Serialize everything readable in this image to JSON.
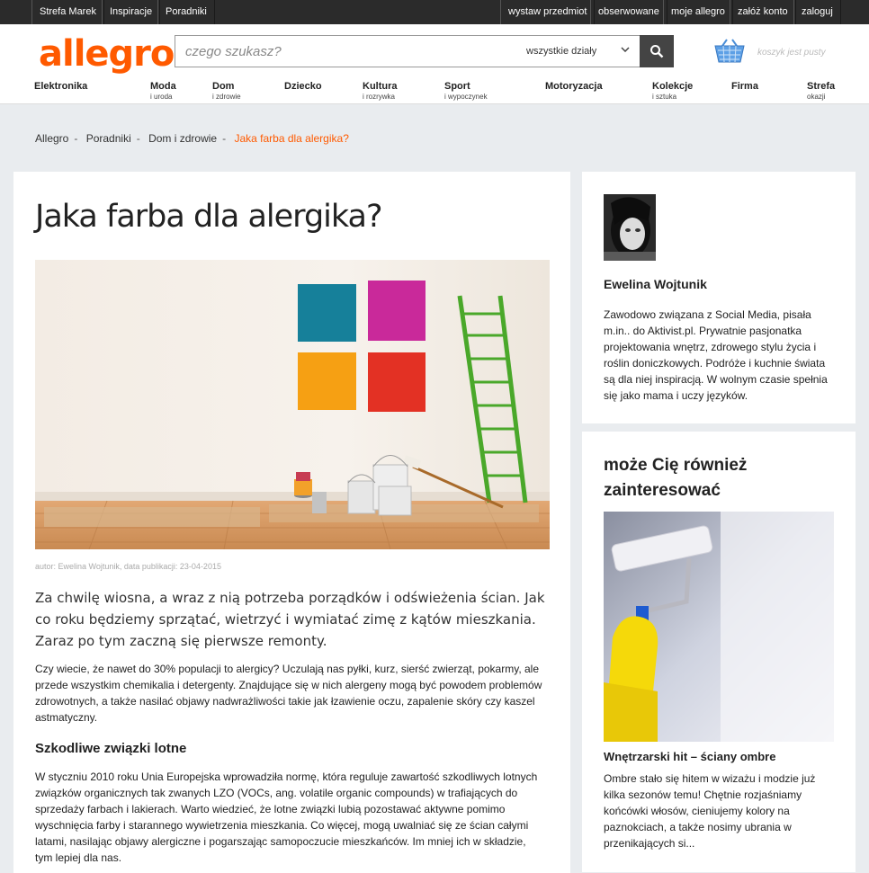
{
  "topbar": {
    "left_links": [
      "Strefa Marek",
      "Inspiracje",
      "Poradniki"
    ],
    "right_links": [
      "wystaw przedmiot",
      "obserwowane",
      "moje allegro",
      "załóż konto",
      "zaloguj"
    ]
  },
  "header": {
    "logo": "allegro",
    "search_placeholder": "czego szukasz?",
    "department": "wszystkie działy",
    "basket_status": "koszyk jest pusty",
    "brand_color": "#ff5a00"
  },
  "categories": [
    {
      "main": "Elektronika",
      "sub": ""
    },
    {
      "main": "Moda",
      "sub": "i uroda"
    },
    {
      "main": "Dom",
      "sub": "i zdrowie"
    },
    {
      "main": "Dziecko",
      "sub": ""
    },
    {
      "main": "Kultura",
      "sub": "i rozrywka"
    },
    {
      "main": "Sport",
      "sub": "i wypoczynek"
    },
    {
      "main": "Motoryzacja",
      "sub": ""
    },
    {
      "main": "Kolekcje",
      "sub": "i sztuka"
    },
    {
      "main": "Firma",
      "sub": ""
    },
    {
      "main": "Strefa",
      "sub": "okazji"
    }
  ],
  "breadcrumb": [
    "Allegro",
    "Poradniki",
    "Dom i zdrowie",
    "Jaka farba dla alergika?"
  ],
  "article": {
    "title": "Jaka farba dla alergika?",
    "byline": "autor: Ewelina Wojtunik, data publikacji: 23-04-2015",
    "lead": "Za chwilę wiosna, a wraz z nią potrzeba porządków i odświeżenia ścian. Jak co roku będziemy sprzątać, wietrzyć i wymiatać zimę z kątów mieszkania. Zaraz po tym zaczną się pierwsze remonty.",
    "paragraph1": "Czy wiecie, że nawet do 30% populacji to alergicy? Uczulają nas pyłki, kurz, sierść zwierząt, pokarmy, ale przede wszystkim chemikalia i detergenty. Znajdujące się w nich alergeny mogą być powodem problemów zdrowotnych, a także nasilać objawy nadwrażliwości takie jak łzawienie oczu, zapalenie skóry czy kaszel astmatyczny.",
    "section_heading": "Szkodliwe związki lotne",
    "paragraph2": "W styczniu 2010 roku Unia Europejska wprowadziła normę, która reguluje zawartość szkodliwych lotnych związków organicznych tak zwanych LZO (VOCs, ang. volatile organic compounds) w trafiających do sprzedaży farbach i lakierach. Warto wiedzieć, że lotne związki lubią pozostawać aktywne pomimo wyschnięcia farby i starannego wywietrzenia mieszkania. Co więcej, mogą uwalniać się ze ścian całymi latami, nasilając objawy alergiczne i pogarszając samopoczucie mieszkańców. Im mniej ich w składzie, tym lepiej dla nas."
  },
  "author": {
    "name": "Ewelina Wojtunik",
    "bio": "Zawodowo związana z Social Media, pisała m.in.. do Aktivist.pl. Prywatnie pasjonatka projektowania wnętrz, zdrowego stylu życia i roślin doniczkowych. Podróże i kuchnie świata są dla niej inspiracją. W wolnym czasie spełnia się jako mama i uczy języków."
  },
  "related": {
    "heading": "może Cię również zainteresować",
    "item_title": "Wnętrzarski hit – ściany ombre",
    "item_desc": "Ombre stało się hitem w wizażu i modzie już kilka sezonów temu! Chętnie rozjaśniamy końcówki włosów, cieniujemy kolory na paznokciach, a także nosimy ubrania w przenikających si..."
  },
  "icons": [
    "search-icon",
    "basket-icon",
    "chevron-down-icon"
  ]
}
